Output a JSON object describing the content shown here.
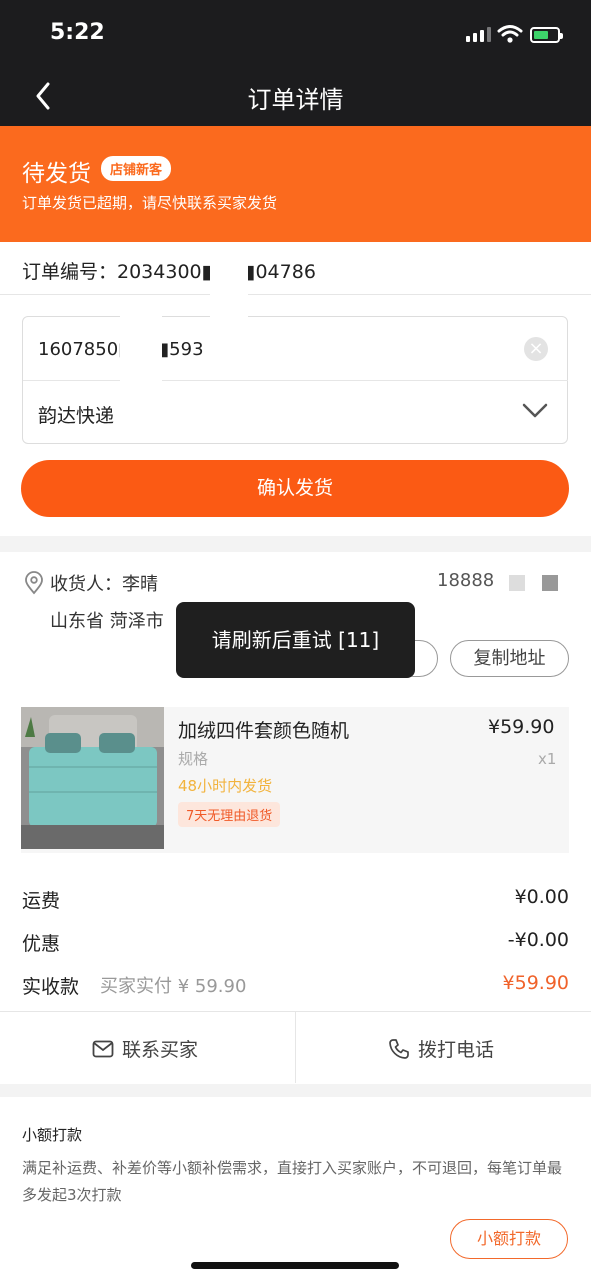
{
  "status_bar": {
    "time": "5:22"
  },
  "nav": {
    "title": "订单详情"
  },
  "order_status": {
    "title": "待发货",
    "badge": "店铺新客",
    "subtitle": "订单发货已超期，请尽快联系买家发货"
  },
  "order": {
    "number": "订单编号：2034300■■■04786"
  },
  "shipping_form": {
    "tracking_number": "1607850■■■593",
    "courier": "韵达快递",
    "confirm_label": "确认发货"
  },
  "address": {
    "receiver": "收货人：李晴",
    "phone": "18888",
    "address_line": "山东省 菏泽市",
    "copy_label": "复制地址"
  },
  "toast": {
    "text": "请刷新后重试 [11]"
  },
  "product": {
    "name": "加绒四件套颜色随机",
    "price": "¥59.90",
    "spec": "规格",
    "qty": "x1",
    "ship_time": "48小时内发货",
    "return_tag": "7天无理由退货"
  },
  "fees": {
    "shipping_label": "运费",
    "shipping_value": "¥0.00",
    "discount_label": "优惠",
    "discount_value": "-¥0.00",
    "received_label": "实收款",
    "buyer_paid": "买家实付 ¥ 59.90",
    "received_value": "¥59.90"
  },
  "actions": {
    "contact_label": "联系买家",
    "call_label": "拨打电话"
  },
  "small_payment": {
    "title": "小额打款",
    "description": "满足补运费、补差价等小额补偿需求，直接打入买家账户，不可退回，每笔订单最多发起3次打款",
    "button_label": "小额打款"
  },
  "colors": {
    "accent": "#fb6a1e",
    "price_orange": "#f0622a",
    "nav_bg": "#1c1c1e"
  }
}
